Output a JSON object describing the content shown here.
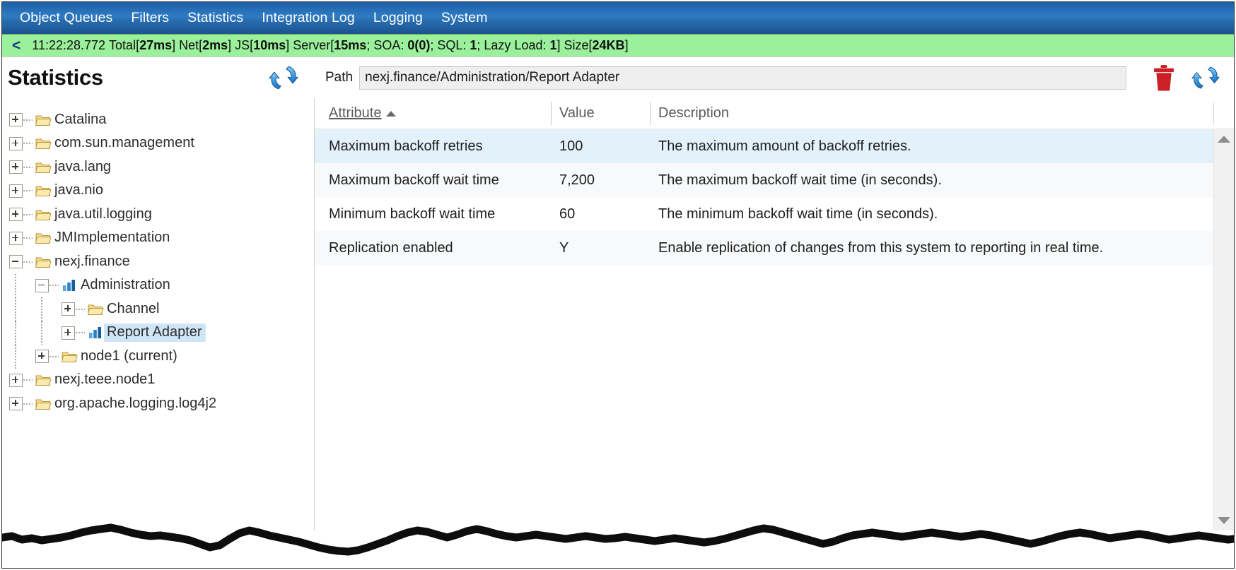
{
  "menubar": {
    "items": [
      {
        "label": "Object Queues"
      },
      {
        "label": "Filters"
      },
      {
        "label": "Statistics"
      },
      {
        "label": "Integration Log"
      },
      {
        "label": "Logging"
      },
      {
        "label": "System"
      }
    ]
  },
  "statusbar": {
    "collapse_chevron": "<",
    "timestamp": "11:22:28.772",
    "total_label": "Total[",
    "total_value": "27ms",
    "net_label": "] Net[",
    "net_value": "2ms",
    "js_label": "] JS[",
    "js_value": "10ms",
    "server_label": "] Server[",
    "server_value": "15ms",
    "soa_label": "; SOA: ",
    "soa_value": "0(0)",
    "sql_label": "; SQL: ",
    "sql_value": "1",
    "lazy_label": "; Lazy Load: ",
    "lazy_value": "1",
    "size_label": "] Size[",
    "size_value": "24KB",
    "size_close": "]",
    "background_color": "#9bf09b"
  },
  "toolbar": {
    "page_title": "Statistics",
    "refresh_left_icon": "refresh-icon",
    "path_label": "Path",
    "path_value": "nexj.finance/Administration/Report Adapter",
    "path_placeholder": "",
    "delete_icon": "trash-icon",
    "refresh_right_icon": "refresh-icon"
  },
  "tree": {
    "items": [
      {
        "label": "Catalina",
        "depth": 0,
        "expander": "plus",
        "icon": "folder-icon",
        "selected": false
      },
      {
        "label": "com.sun.management",
        "depth": 0,
        "expander": "plus",
        "icon": "folder-icon",
        "selected": false
      },
      {
        "label": "java.lang",
        "depth": 0,
        "expander": "plus",
        "icon": "folder-icon",
        "selected": false
      },
      {
        "label": "java.nio",
        "depth": 0,
        "expander": "plus",
        "icon": "folder-icon",
        "selected": false
      },
      {
        "label": "java.util.logging",
        "depth": 0,
        "expander": "plus",
        "icon": "folder-icon",
        "selected": false
      },
      {
        "label": "JMImplementation",
        "depth": 0,
        "expander": "plus",
        "icon": "folder-icon",
        "selected": false
      },
      {
        "label": "nexj.finance",
        "depth": 0,
        "expander": "minus",
        "icon": "folder-icon",
        "selected": false
      },
      {
        "label": "Administration",
        "depth": 1,
        "expander": "minus",
        "icon": "chart-icon",
        "selected": false
      },
      {
        "label": "Channel",
        "depth": 2,
        "expander": "plus",
        "icon": "folder-icon",
        "selected": false
      },
      {
        "label": "Report Adapter",
        "depth": 2,
        "expander": "plus",
        "icon": "chart-icon",
        "selected": true
      },
      {
        "label": "node1 (current)",
        "depth": 1,
        "expander": "plus",
        "icon": "folder-icon",
        "selected": false
      },
      {
        "label": "nexj.teee.node1",
        "depth": 0,
        "expander": "plus",
        "icon": "folder-icon",
        "selected": false
      },
      {
        "label": "org.apache.logging.log4j2",
        "depth": 0,
        "expander": "plus",
        "icon": "folder-icon",
        "selected": false
      }
    ]
  },
  "table": {
    "columns": [
      {
        "label": "Attribute",
        "sorted": true,
        "sort_direction": "ascending"
      },
      {
        "label": "Value",
        "sorted": false,
        "sort_direction": ""
      },
      {
        "label": "Description",
        "sorted": false,
        "sort_direction": ""
      }
    ],
    "rows": [
      {
        "attribute": "Maximum backoff retries",
        "value": "100",
        "description": "The maximum amount of backoff retries.",
        "selected": true
      },
      {
        "attribute": "Maximum backoff wait time",
        "value": "7,200",
        "description": "The maximum backoff wait time (in seconds).",
        "selected": false
      },
      {
        "attribute": "Minimum backoff wait time",
        "value": "60",
        "description": "The minimum backoff wait time (in seconds).",
        "selected": false
      },
      {
        "attribute": "Replication enabled",
        "value": "Y",
        "description": "Enable replication of changes from this system to reporting in real time.",
        "selected": false
      }
    ]
  },
  "scrollbar": {
    "up_arrow_icon": "triangle-up-icon",
    "down_arrow_icon": "triangle-down-icon"
  },
  "colors": {
    "menubar": "#2a6fb2",
    "status_green": "#9bf09b",
    "selection_blue": "#e3f1fb",
    "tree_selection": "#cfe6f7",
    "accent_red": "#cc2026",
    "accent_blue": "#2e8bd8"
  }
}
